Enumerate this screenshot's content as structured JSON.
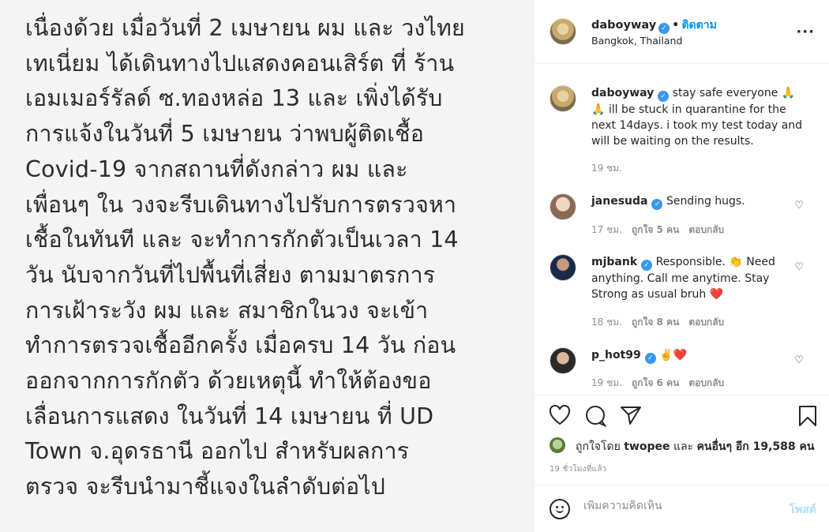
{
  "post_text_lines": [
    "เนื่องด้วย เมื่อวันที่ 2 เมษายน ผม และ วงไทย",
    "เทเนี่ยม ได้เดินทางไปแสดงคอนเสิร์ต ที่ ร้าน",
    "เอมเมอร์รัลด์ ซ.ทองหล่อ 13  และ เพิ่งได้รับ",
    "การแจ้งในวันที่ 5 เมษายน ว่าพบผู้ติดเชื้อ",
    "Covid-19 จากสถานที่ดังกล่าว  ผม และ",
    "เพื่อนๆ ใน วงจะรีบเดินทางไปรับการตรวจหา",
    "เชื้อในทันที และ จะทำการกักตัวเป็นเวลา 14",
    "วัน นับจากวันที่ไปพื้นที่เสี่ยง ตามมาตรการ",
    "การเฝ้าระวัง  ผม และ สมาชิกในวง จะเข้า",
    "ทำการตรวจเชื้ออีกครั้ง เมื่อครบ 14 วัน ก่อน",
    "ออกจากการกักตัว ด้วยเหตุนี้ ทำให้ต้องขอ",
    "เลื่อนการแสดง ในวันที่ 14 เมษายน ที่ UD",
    "Town จ.อุดรธานี  ออกไป สำหรับผลการ",
    "ตรวจ จะรีบนำมาชี้แจงในลำดับต่อไป"
  ],
  "header": {
    "username": "daboyway",
    "separator": "•",
    "follow_label": "ติดตาม",
    "location": "Bangkok, Thailand",
    "more_icon": "more-horizontal-icon"
  },
  "caption": {
    "username": "daboyway",
    "text": "stay safe everyone 🙏 🙏 ill be stuck in quarantine for the next 14days. i took my test today and will be waiting on the results.",
    "time": "19 ชม."
  },
  "comments": [
    {
      "username": "janesuda",
      "text": "Sending hugs.",
      "time": "17 ชม.",
      "likes": "ถูกใจ 5 คน",
      "reply": "ตอบกลับ"
    },
    {
      "username": "mjbank",
      "text": "Responsible. 👏 Need anything. Call me anytime. Stay Strong as usual bruh ❤️",
      "time": "18 ชม.",
      "likes": "ถูกใจ 8 คน",
      "reply": "ตอบกลับ"
    },
    {
      "username": "p_hot99",
      "text": "✌️❤️",
      "time": "19 ชม.",
      "likes": "ถูกใจ 6 คน",
      "reply": "ตอบกลับ"
    }
  ],
  "actions": {
    "liked_by_prefix": "ถูกใจโดย",
    "liked_by_user": "twopee",
    "liked_by_and": "และ",
    "liked_by_others": "คนอื่นๆ อีก 19,588 คน",
    "time_ago": "19 ชั่วโมงที่แล้ว"
  },
  "comment_box": {
    "placeholder": "เพิ่มความคิดเห็น",
    "post_label": "โพสต์"
  },
  "colors": {
    "accent": "#0095f6",
    "verified": "#3897f0",
    "muted": "#8e8e8e",
    "post_disabled": "#b2dffc"
  }
}
